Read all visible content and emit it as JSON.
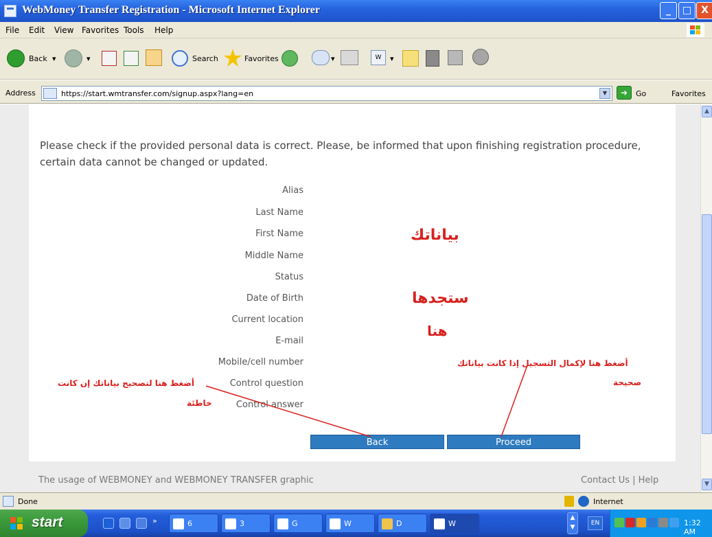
{
  "window": {
    "title": "WebMoney Transfer Registration - Microsoft Internet Explorer",
    "controls": {
      "minimize": "_",
      "maximize": "□",
      "close": "X"
    }
  },
  "menu": [
    "File",
    "Edit",
    "View",
    "Favorites",
    "Tools",
    "Help"
  ],
  "toolbar": {
    "back_label": "Back",
    "search_label": "Search",
    "favorites_label": "Favorites"
  },
  "address": {
    "label": "Address",
    "url": "https://start.wmtransfer.com/signup.aspx?lang=en",
    "go_label": "Go",
    "favorites_label": "Favorites"
  },
  "page": {
    "intro": "Please check if the provided personal data is correct. Please, be informed that upon finishing registration procedure, certain data cannot be changed or updated.",
    "fields": [
      "Alias",
      "Last Name",
      "First Name",
      "Middle Name",
      "Status",
      "Date of Birth",
      "Current location",
      "E-mail",
      "Mobile/cell number",
      "Control question",
      "Control answer"
    ],
    "back_label": "Back",
    "proceed_label": "Proceed",
    "footer_left": "The usage of WEBMONEY and WEBMONEY TRANSFER graphic",
    "footer_right": "Contact Us | Help"
  },
  "annotations": {
    "data_word": "بياناتك",
    "find_word": "ستجدها",
    "here_word": "هنا",
    "proceed_note_1": "أضغط هنا لإكمال التسجيل إذا كانت بياناتك",
    "proceed_note_2": "صحيحة",
    "back_note_1": "أضغط هنا لتصحيح بياناتك إن كانت",
    "back_note_2": "خاطئة"
  },
  "statusbar": {
    "status": "Done",
    "zone": "Internet"
  },
  "taskbar": {
    "start_label": "start",
    "tasks": [
      {
        "label": "6"
      },
      {
        "label": "3"
      },
      {
        "label": "G"
      },
      {
        "label": "W"
      },
      {
        "label": "D"
      },
      {
        "label": "W"
      }
    ],
    "lang": "EN",
    "clock": "1:32 AM"
  },
  "colors": {
    "accent_button": "#2e7bc0",
    "annotation_red": "#d8201d",
    "xp_blue": "#245edb",
    "start_green": "#3b9a3b"
  }
}
